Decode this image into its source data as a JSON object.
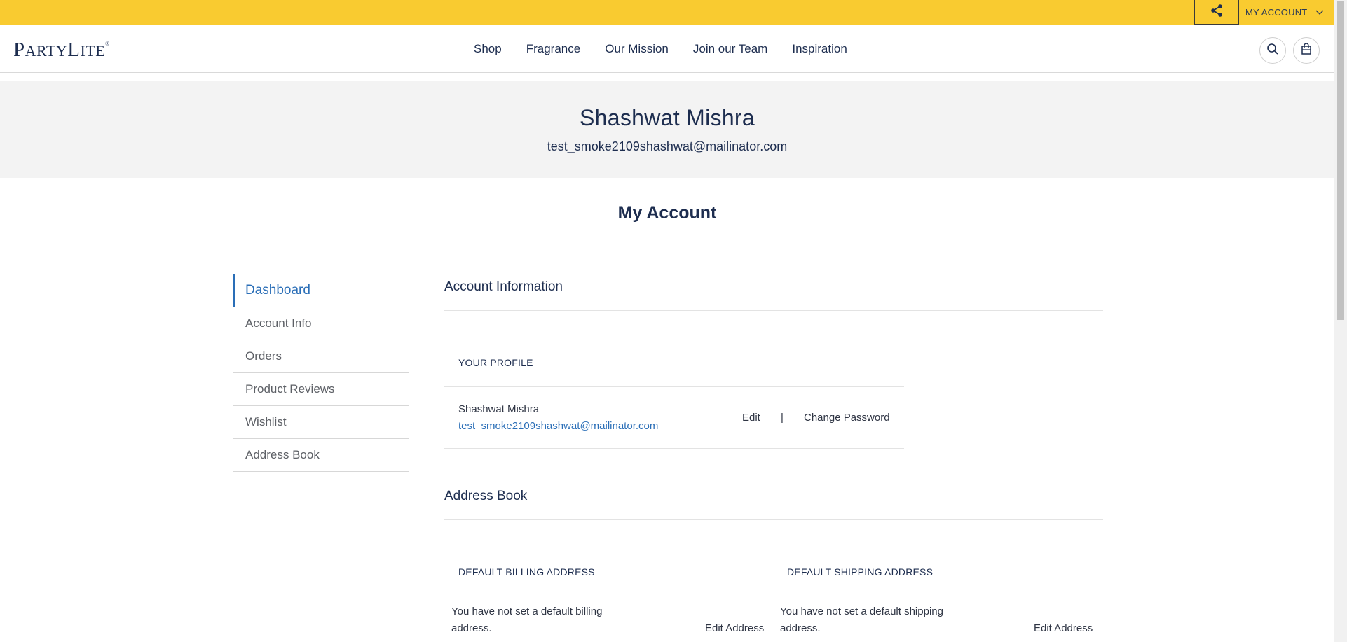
{
  "topbar": {
    "account_label": "MY ACCOUNT",
    "background": "#f9cb30"
  },
  "header": {
    "logo_text": "PartyLite",
    "logo_first": "P",
    "logo_rest1": "ARTY",
    "logo_second": "L",
    "logo_rest2": "ITE",
    "nav": [
      "Shop",
      "Fragrance",
      "Our Mission",
      "Join our Team",
      "Inspiration"
    ]
  },
  "banner": {
    "name": "Shashwat Mishra",
    "email": "test_smoke2109shashwat@mailinator.com"
  },
  "page_title": "My Account",
  "sidebar": {
    "items": [
      "Dashboard",
      "Account Info",
      "Orders",
      "Product Reviews",
      "Wishlist",
      "Address Book"
    ],
    "active": "Dashboard"
  },
  "account_info": {
    "title": "Account Information",
    "profile_label": "YOUR PROFILE",
    "name": "Shashwat Mishra",
    "email": "test_smoke2109shashwat@mailinator.com",
    "edit": "Edit",
    "separator": "|",
    "change_password": "Change Password"
  },
  "address_book": {
    "title": "Address Book",
    "billing_label": "DEFAULT BILLING ADDRESS",
    "shipping_label": "DEFAULT SHIPPING ADDRESS",
    "billing_text_1": "You have not set a default billing",
    "billing_text_2": "address.",
    "shipping_text_1": "You have not set a default shipping",
    "shipping_text_2": "address.",
    "edit_address": "Edit Address"
  },
  "colors": {
    "accent": "#2a6eb7",
    "navy": "#1d2d4f",
    "banner_bg": "#f3f3f3"
  }
}
